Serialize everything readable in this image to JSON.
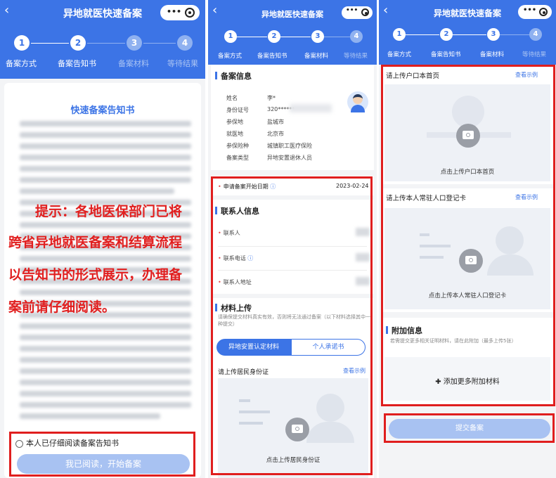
{
  "app": {
    "title": "异地就医快速备案"
  },
  "steps": [
    "备案方式",
    "备案告知书",
    "备案材料",
    "等待结果"
  ],
  "step_numbers": [
    "1",
    "2",
    "3",
    "4"
  ],
  "panel1": {
    "card_title": "快速备案告知书",
    "notice_lines": [
      "提示：各地医保部门已将",
      "跨省异地就医备案和结算流程",
      "以告知书的形式展示，办理备",
      "案前请仔细阅读。"
    ],
    "checkbox_label": "本人已仔细阅读备案告知书",
    "start_button": "我已阅读，开始备案"
  },
  "panel2": {
    "info_title": "备案信息",
    "info_rows": [
      {
        "label": "姓名",
        "value": "李*"
      },
      {
        "label": "身份证号",
        "value": "320******"
      },
      {
        "label": "参保地",
        "value": "盐城市"
      },
      {
        "label": "就医地",
        "value": "北京市"
      },
      {
        "label": "参保险种",
        "value": "城镇职工医疗保险"
      },
      {
        "label": "备案类型",
        "value": "异地安置退休人员"
      }
    ],
    "start_date_label": "申请备案开始日期",
    "start_date_value": "2023-02-24",
    "contact_title": "联系人信息",
    "contact_fields": [
      "联系人",
      "联系电话",
      "联系人地址"
    ],
    "material_title": "材料上传",
    "material_hint": "请确保提交材料真实有效，否则将无法通过备案（以下材料选择其中一种提交）",
    "tabs": [
      "异地安置认定材料",
      "个人承诺书"
    ],
    "upload_label": "请上传居民身份证",
    "example_link": "查看示例",
    "upload_caption": "点击上传居民身份证"
  },
  "panel3": {
    "upload1_label": "请上传户口本首页",
    "upload1_caption": "点击上传户口本首页",
    "upload2_label": "请上传本人常驻人口登记卡",
    "upload2_caption": "点击上传本人常驻人口登记卡",
    "example_link": "查看示例",
    "extra_title": "附加信息",
    "extra_hint": "若需提交更多相关证明材料，请在此附加（最多上传5张）",
    "add_more": "添加更多附加材料",
    "submit_button": "提交备案"
  },
  "colors": {
    "primary": "#3c74e6",
    "annotation_red": "#e01e1e"
  }
}
